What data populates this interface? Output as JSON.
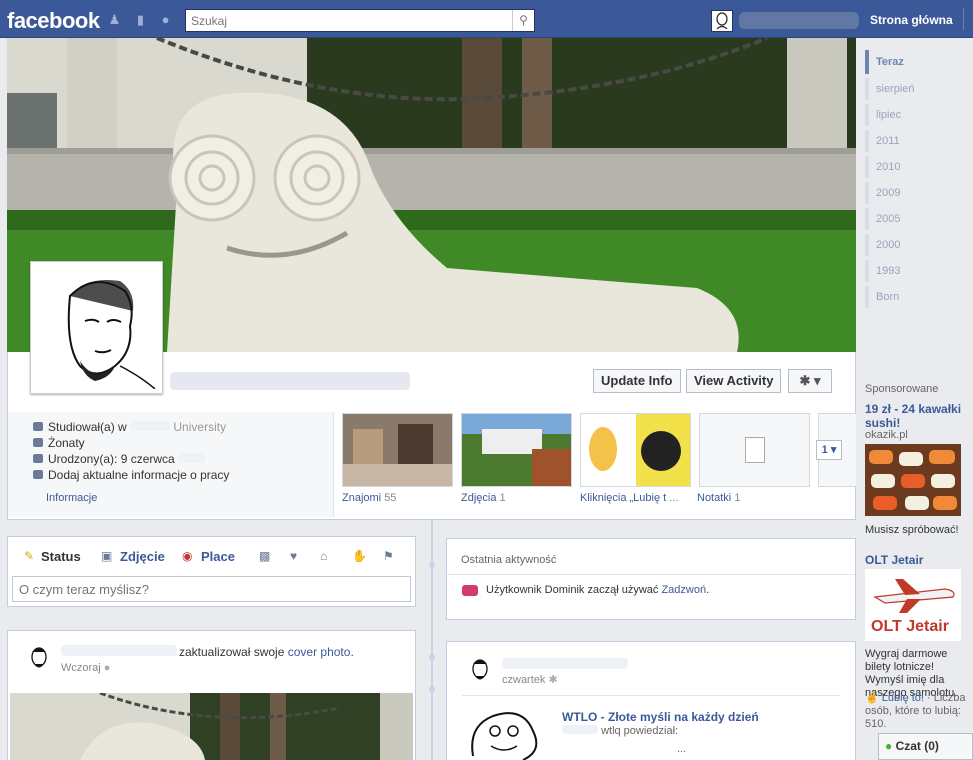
{
  "topbar": {
    "logo": "facebook",
    "search_placeholder": "Szukaj",
    "home_label": "Strona główna"
  },
  "profile": {
    "update_info": "Update Info",
    "view_activity": "View Activity",
    "settings_icon": "gear-icon",
    "info": {
      "studied": "Studiował(a) w",
      "studied_tail": "University",
      "married": "Żonaty",
      "born": "Urodzony(a): 9 czerwca",
      "add_work": "Dodaj aktualne informacje o pracy",
      "section_link": "Informacje"
    },
    "tiles": [
      {
        "label": "Znajomi",
        "count": "55"
      },
      {
        "label": "Zdjęcia",
        "count": "1"
      },
      {
        "label": "Kliknięcia „Lubię t",
        "count": "..."
      },
      {
        "label": "Notatki",
        "count": "1"
      }
    ],
    "page_button": "1"
  },
  "composer": {
    "tabs": [
      "Status",
      "Zdjęcie",
      "Place"
    ],
    "placeholder": "O czym teraz myślisz?"
  },
  "activity": {
    "title": "Ostatnia aktywność",
    "text_before": "Użytkownik Dominik zaczął używać",
    "app": "Zadzwoń",
    "text_after": "."
  },
  "post1": {
    "action": "zaktualizował swoje",
    "link": "cover photo",
    "dot": ".",
    "time": "Wczoraj"
  },
  "post2": {
    "time": "czwartek",
    "app_title": "WTLO - Złote myśli na każdy dzień",
    "app_sub": "wtlq powiedział:",
    "ellipsis": "..."
  },
  "timeline_nav": {
    "items": [
      "Teraz",
      "sierpień",
      "lipiec",
      "2011",
      "2010",
      "2009",
      "2005",
      "2000",
      "1993",
      "Born"
    ]
  },
  "ads": {
    "header": "Sponsorowane",
    "ad1": {
      "title": "19 zł - 24 kawałki sushi!",
      "domain": "okazik.pl",
      "text": "Musisz spróbować!"
    },
    "ad2": {
      "title": "OLT Jetair",
      "brand": "OLT Jetair",
      "text": "Wygraj darmowe bilety lotnicze! Wymyśl imię dla naszego samolotu.",
      "like": "Lubię to!",
      "likes_text": "· Liczba osób, które to lubią: 510."
    }
  },
  "chat": {
    "label": "Czat (0)"
  }
}
